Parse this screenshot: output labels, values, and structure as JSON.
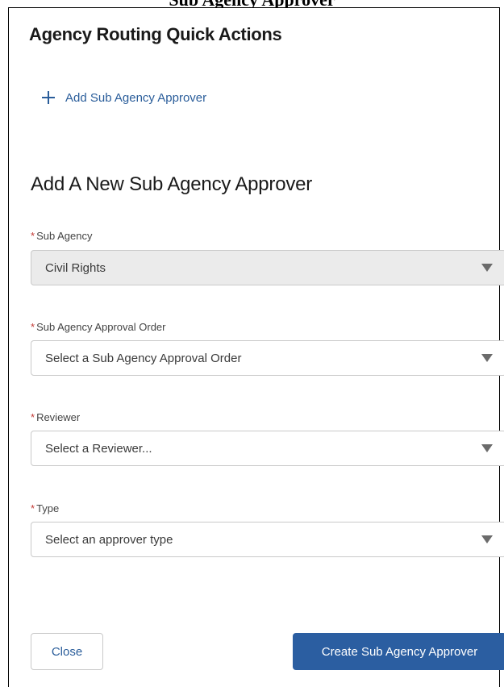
{
  "header": {
    "cut_title": "Sub Agency Approver"
  },
  "panel": {
    "title": "Agency Routing Quick Actions",
    "add_link_label": "Add Sub Agency Approver",
    "section_title": "Add A New Sub Agency Approver"
  },
  "form": {
    "required_marker": "*",
    "sub_agency": {
      "label": "Sub Agency",
      "value": "Civil Rights",
      "disabled": true
    },
    "approval_order": {
      "label": "Sub Agency Approval Order",
      "placeholder": "Select a Sub Agency Approval Order"
    },
    "reviewer": {
      "label": "Reviewer",
      "placeholder": "Select a Reviewer..."
    },
    "type": {
      "label": "Type",
      "placeholder": "Select an approver type"
    }
  },
  "footer": {
    "close_label": "Close",
    "create_label": "Create Sub Agency Approver"
  },
  "colors": {
    "accent": "#2b5ea1",
    "link": "#2a5d9a",
    "required": "#c23934"
  },
  "icons": {
    "add": "plus-icon",
    "dropdown": "caret-down-icon"
  }
}
